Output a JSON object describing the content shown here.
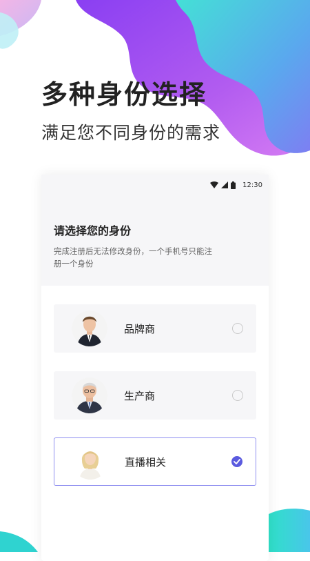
{
  "hero": {
    "title": "多种身份选择",
    "subtitle": "满足您不同身份的需求"
  },
  "status_bar": {
    "time": "12:30",
    "icons": [
      "wifi-icon",
      "signal-icon",
      "battery-icon"
    ]
  },
  "identity_panel": {
    "title": "请选择您的身份",
    "description": "完成注册后无法修改身份，一个手机号只能注册一个身份"
  },
  "options": [
    {
      "label": "品牌商",
      "selected": false,
      "avatar": "man-in-suit-avatar"
    },
    {
      "label": "生产商",
      "selected": false,
      "avatar": "older-man-with-glasses-avatar"
    },
    {
      "label": "直播相关",
      "selected": true,
      "avatar": "blonde-woman-avatar"
    }
  ],
  "colors": {
    "accent": "#5b5bdf",
    "selected_border": "#8d8df0",
    "option_bg": "#f6f6f8",
    "blob_purple": "#9b5cf5",
    "blob_cyan": "#3fd3e0"
  }
}
